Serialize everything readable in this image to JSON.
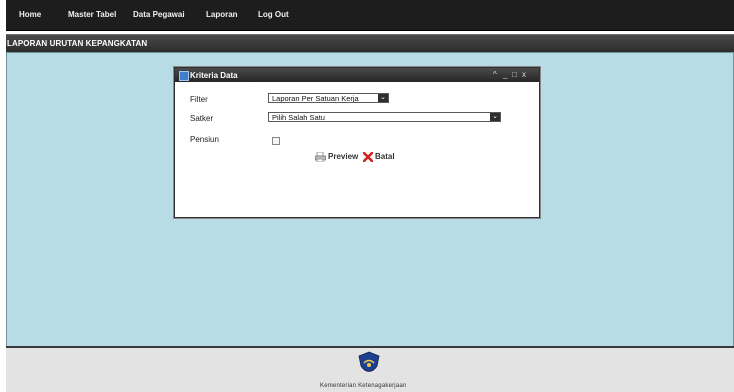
{
  "nav": {
    "items": [
      {
        "label": "Home"
      },
      {
        "label": "Master Tabel"
      },
      {
        "label": "Data Pegawai"
      },
      {
        "label": "Laporan"
      },
      {
        "label": "Log Out"
      }
    ]
  },
  "page": {
    "title": "LAPORAN URUTAN KEPANGKATAN"
  },
  "dialog": {
    "title": "Kriteria Data",
    "window_controls": [
      "^",
      "_",
      "□",
      "x"
    ],
    "fields": {
      "filter_label": "Filter",
      "filter_value": "Laporan Per Satuan Kerja",
      "satker_label": "Satker",
      "satker_value": "Pilih Salah Satu",
      "pensiun_label": "Pensiun"
    },
    "buttons": {
      "preview": "Preview",
      "batal": "Batal"
    },
    "icons": {
      "preview": "printer-preview-icon",
      "batal": "red-x-icon",
      "window": "window-icon"
    }
  },
  "footer": {
    "org_name": "Kementerian Ketenagakerjaan",
    "logo": "ministry-shield-logo"
  },
  "colors": {
    "nav_bg": "#1d1d1d",
    "workarea_bg": "#b7dce6",
    "footer_bg": "#e3e3e3"
  }
}
